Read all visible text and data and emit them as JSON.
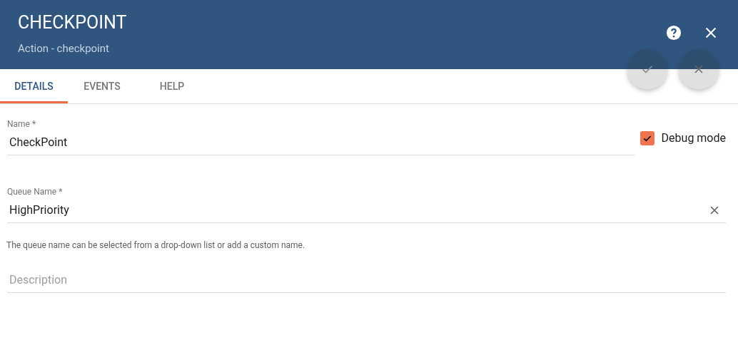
{
  "header": {
    "title": "CHECKPOINT",
    "subtitle": "Action - checkpoint"
  },
  "tabs": [
    {
      "label": "DETAILS",
      "selected": true
    },
    {
      "label": "EVENTS",
      "selected": false
    },
    {
      "label": "HELP",
      "selected": false
    }
  ],
  "fields": [
    {
      "label": "Name *",
      "value": "CheckPoint",
      "clearable": false
    },
    {
      "label": "Queue Name *",
      "value": "HighPriority",
      "clearable": true,
      "hint": "The queue name can be selected from a drop-down list or add a custom name."
    },
    {
      "placeholder": "Description",
      "clearable": false
    }
  ],
  "debug_mode": {
    "label": "Debug mode",
    "checked": true
  }
}
